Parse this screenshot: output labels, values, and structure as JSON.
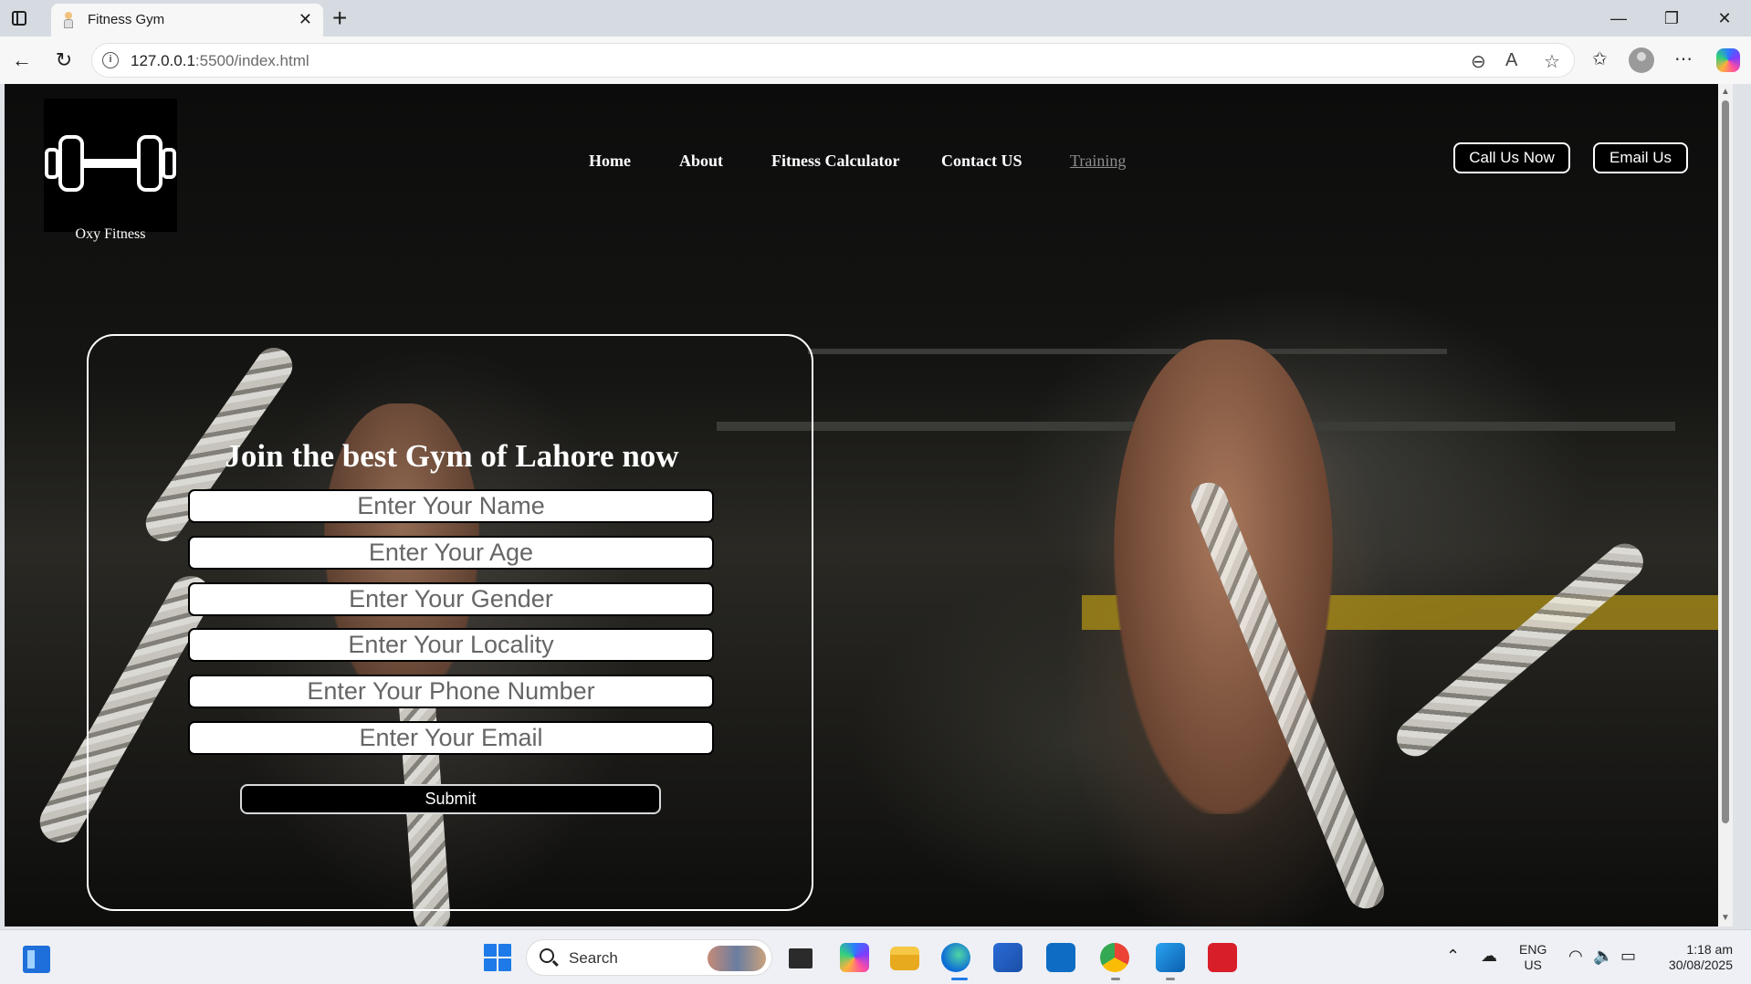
{
  "browser": {
    "tab_title": "Fitness Gym",
    "url_host": "127.0.0.1",
    "url_rest": ":5500/index.html"
  },
  "site": {
    "logo_caption": "Oxy Fitness",
    "nav": [
      {
        "label": "Home"
      },
      {
        "label": "About"
      },
      {
        "label": "Fitness Calculator"
      },
      {
        "label": "Contact US"
      },
      {
        "label": "Training"
      }
    ],
    "cta": {
      "call": "Call Us Now",
      "email": "Email Us"
    },
    "form": {
      "heading": "Join the best Gym of Lahore now",
      "fields": [
        {
          "placeholder": "Enter Your Name"
        },
        {
          "placeholder": "Enter Your Age"
        },
        {
          "placeholder": "Enter Your Gender"
        },
        {
          "placeholder": "Enter Your Locality"
        },
        {
          "placeholder": "Enter Your Phone Number"
        },
        {
          "placeholder": "Enter Your Email"
        }
      ],
      "submit_label": "Submit"
    }
  },
  "taskbar": {
    "search_label": "Search",
    "language": "ENG",
    "region": "US",
    "time": "1:18 am",
    "date": "30/08/2025"
  },
  "colors": {
    "accent_blue": "#1e7ae8",
    "page_bg": "#151513",
    "link_visited": "#8d8d8d"
  }
}
